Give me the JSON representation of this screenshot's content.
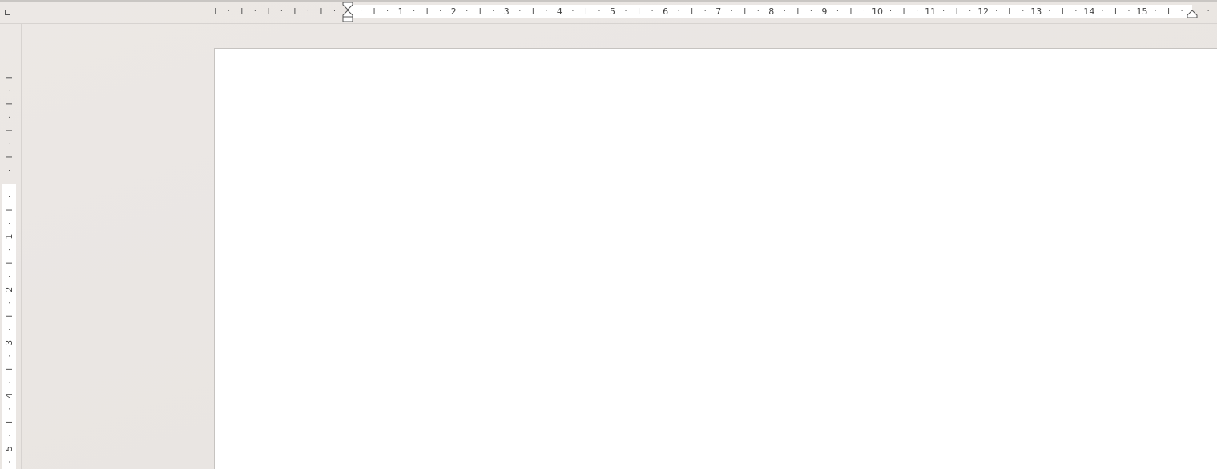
{
  "app": {
    "name": "word-processor-document-view"
  },
  "horizontal_ruler": {
    "unit_labels": [
      "1",
      "2",
      "3",
      "4",
      "5",
      "6",
      "7",
      "8",
      "9",
      "10",
      "11",
      "12",
      "13",
      "14",
      "15"
    ],
    "icons": {
      "tab_selector": "left-tab-stop-icon",
      "first_line_indent": "first-line-indent-marker-icon",
      "hanging_indent": "hanging-indent-marker-icon",
      "left_indent": "left-indent-marker-icon",
      "right_indent": "right-indent-marker-icon"
    }
  },
  "vertical_ruler": {
    "unit_labels": [
      "1",
      "2",
      "3",
      "4",
      "5"
    ]
  },
  "document": {
    "content": ""
  },
  "colors": {
    "workspace_bg": "#eae6e3",
    "ruler_active": "#ffffff",
    "page_bg": "#ffffff",
    "tick": "#555555"
  }
}
